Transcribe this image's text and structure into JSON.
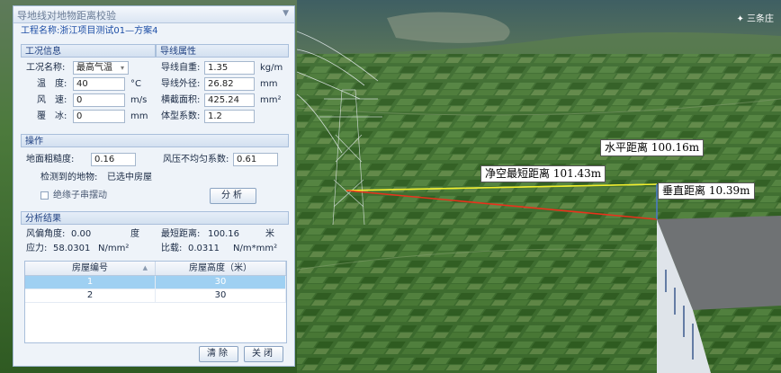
{
  "panel": {
    "title": "导地线对地物距离校验",
    "project_label": "工程名称:",
    "project_name": "浙江项目测试01—方案4"
  },
  "condition": {
    "section": "工况信息",
    "name_label": "工况名称:",
    "name_value": "最高气温",
    "temp_label": "温　度:",
    "temp_value": "40",
    "temp_unit": "°C",
    "wind_label": "风　速:",
    "wind_value": "0",
    "wind_unit": "m/s",
    "ice_label": "覆　冰:",
    "ice_value": "0",
    "ice_unit": "mm"
  },
  "conductor": {
    "section": "导线属性",
    "weight_label": "导线自重:",
    "weight_value": "1.35",
    "weight_unit": "kg/m",
    "diameter_label": "导线外径:",
    "diameter_value": "26.82",
    "diameter_unit": "mm",
    "area_label": "横截面积:",
    "area_value": "425.24",
    "area_unit": "mm²",
    "shape_label": "体型系数:",
    "shape_value": "1.2"
  },
  "operation": {
    "section": "操作",
    "roughness_label": "地面粗糙度:",
    "roughness_value": "0.16",
    "wind_coef_label": "风压不均匀系数:",
    "wind_coef_value": "0.61",
    "detected_label": "检测到的地物:",
    "detected_value": "已选中房屋",
    "insulator_label": "绝缘子串摆动",
    "insulator_checked": false,
    "analyze_button": "分析"
  },
  "results": {
    "section": "分析结果",
    "windangle_label": "风偏角度:",
    "windangle_value": "0.00",
    "windangle_unit": "度",
    "mindist_label": "最短距离:",
    "mindist_value": "100.16",
    "mindist_unit": "米",
    "stress_label": "应力:",
    "stress_value": "58.0301",
    "stress_unit": "N/mm²",
    "ratio_label": "比载:",
    "ratio_value": "0.0311",
    "ratio_unit": "N/m*mm²",
    "columns": [
      "房屋编号",
      "房屋高度（米）"
    ],
    "rows": [
      {
        "id": "1",
        "height": "30"
      },
      {
        "id": "2",
        "height": "30"
      }
    ],
    "selected_row": 0
  },
  "footer": {
    "clear_button": "清除",
    "close_button": "关闭"
  },
  "scene": {
    "compass": "✦ 三条庄",
    "horizontal_label": "水平距离 100.16m",
    "clearance_label": "净空最短距离 101.43m",
    "vertical_label": "垂直距离 10.39m",
    "colors": {
      "horizontal_line": "#ffffff",
      "clearance_line": "#f2ef2a",
      "vertical_line": "#e8321c",
      "building_roof": "#6f7274",
      "building_wall": "#dfe4ea"
    }
  }
}
